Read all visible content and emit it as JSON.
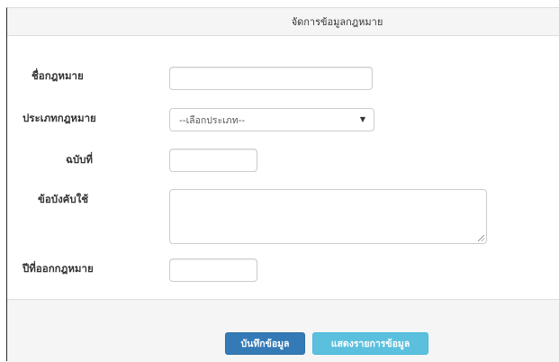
{
  "panel": {
    "title": "จัดการข้อมูลกฎหมาย"
  },
  "form": {
    "law_name_label": "ชื่อกฎหมาย",
    "law_name_value": "",
    "law_type_label": "ประเภทกฎหมาย",
    "law_type_selected": "--เลือกประเภท--",
    "issue_no_label": "ฉบับที่",
    "issue_no_value": "",
    "enforcement_label": "ข้อบังคับใช้",
    "enforcement_value": "",
    "year_label": "ปีที่ออกกฎหมาย",
    "year_value": ""
  },
  "footer": {
    "save_label": "บันทึกข้อมูล",
    "list_label": "แสดงรายการข้อมูล"
  },
  "colors": {
    "primary": "#337ab7",
    "info": "#5bc0de",
    "panel_bg": "#f5f5f5"
  }
}
